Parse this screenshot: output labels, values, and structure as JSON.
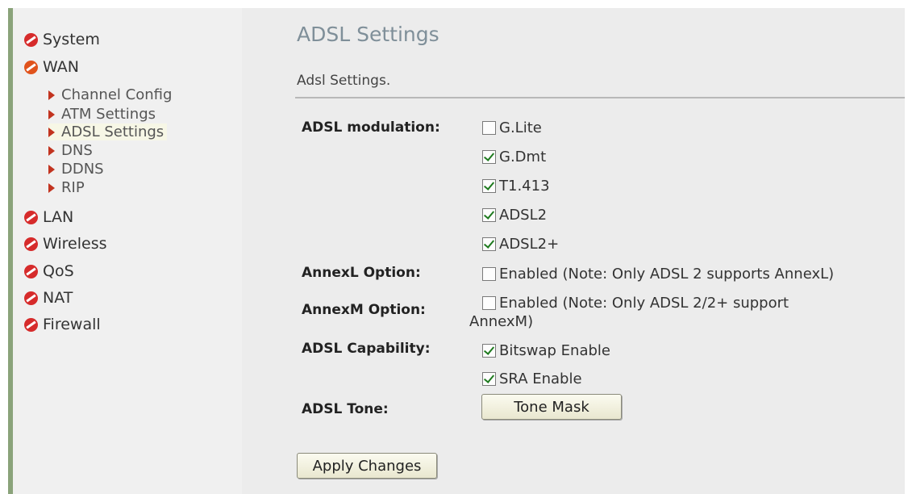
{
  "sidebar": {
    "items": [
      {
        "label": "System"
      },
      {
        "label": "WAN"
      },
      {
        "label": "LAN"
      },
      {
        "label": "Wireless"
      },
      {
        "label": "QoS"
      },
      {
        "label": "NAT"
      },
      {
        "label": "Firewall"
      }
    ],
    "wan_sub_items": [
      {
        "label": "Channel Config"
      },
      {
        "label": "ATM Settings"
      },
      {
        "label": "ADSL Settings"
      },
      {
        "label": "DNS"
      },
      {
        "label": "DDNS"
      },
      {
        "label": "RIP"
      }
    ]
  },
  "main": {
    "title": "ADSL Settings",
    "subtitle": "Adsl Settings.",
    "modulation": {
      "label": "ADSL modulation:",
      "options": [
        {
          "label": "G.Lite",
          "checked": false
        },
        {
          "label": "G.Dmt",
          "checked": true
        },
        {
          "label": "T1.413",
          "checked": true
        },
        {
          "label": "ADSL2",
          "checked": true
        },
        {
          "label": "ADSL2+",
          "checked": true
        }
      ]
    },
    "annexl": {
      "label": "AnnexL Option:",
      "option_label": "Enabled (Note: Only ADSL 2 supports AnnexL)",
      "checked": false
    },
    "annexm": {
      "label": "AnnexM Option:",
      "option_label_line1": "Enabled (Note: Only ADSL 2/2+ support",
      "option_label_line2": "AnnexM)",
      "checked": false
    },
    "capability": {
      "label": "ADSL Capability:",
      "options": [
        {
          "label": "Bitswap Enable",
          "checked": true
        },
        {
          "label": "SRA Enable",
          "checked": true
        }
      ]
    },
    "tone": {
      "label": "ADSL Tone:",
      "button_label": "Tone Mask"
    },
    "apply_label": "Apply Changes"
  },
  "colors": {
    "menu_icon": "#d62b2b",
    "sub_arrow": "#c2331f",
    "title": "#7f8f99",
    "check_mark": "#1e7a1e"
  }
}
